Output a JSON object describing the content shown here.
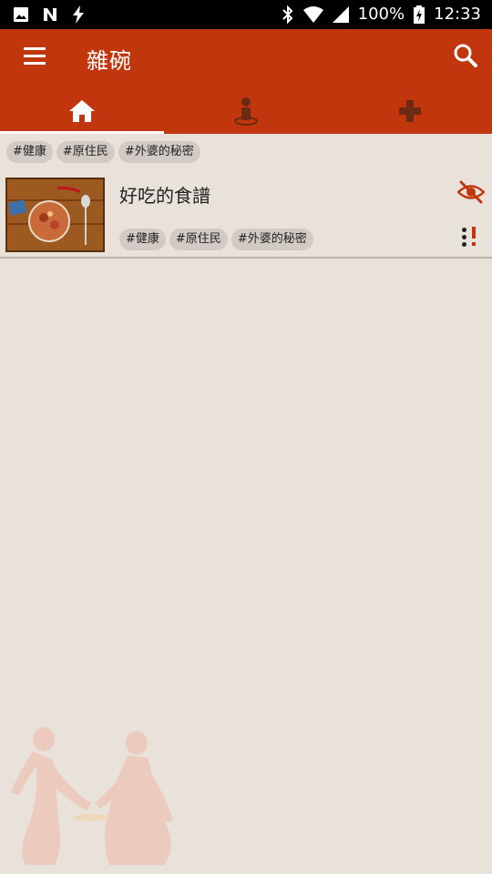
{
  "status_bar": {
    "battery": "100%",
    "time": "12:33"
  },
  "app_bar": {
    "title": "雜碗"
  },
  "tabs": [
    {
      "name": "home",
      "icon": "home-icon",
      "selected": true
    },
    {
      "name": "profile",
      "icon": "person-icon",
      "selected": false
    },
    {
      "name": "add",
      "icon": "plus-icon",
      "selected": false
    }
  ],
  "filter_tags": [
    "#健康",
    "#原住民",
    "#外婆的秘密"
  ],
  "recipes": [
    {
      "title": "好吃的食譜",
      "tags": [
        "#健康",
        "#原住民",
        "#外婆的秘密"
      ]
    }
  ],
  "colors": {
    "primary": "#c2360e",
    "background": "#e9e2db",
    "chip": "#d2cbc5",
    "tab_inactive": "#6b2a12"
  }
}
